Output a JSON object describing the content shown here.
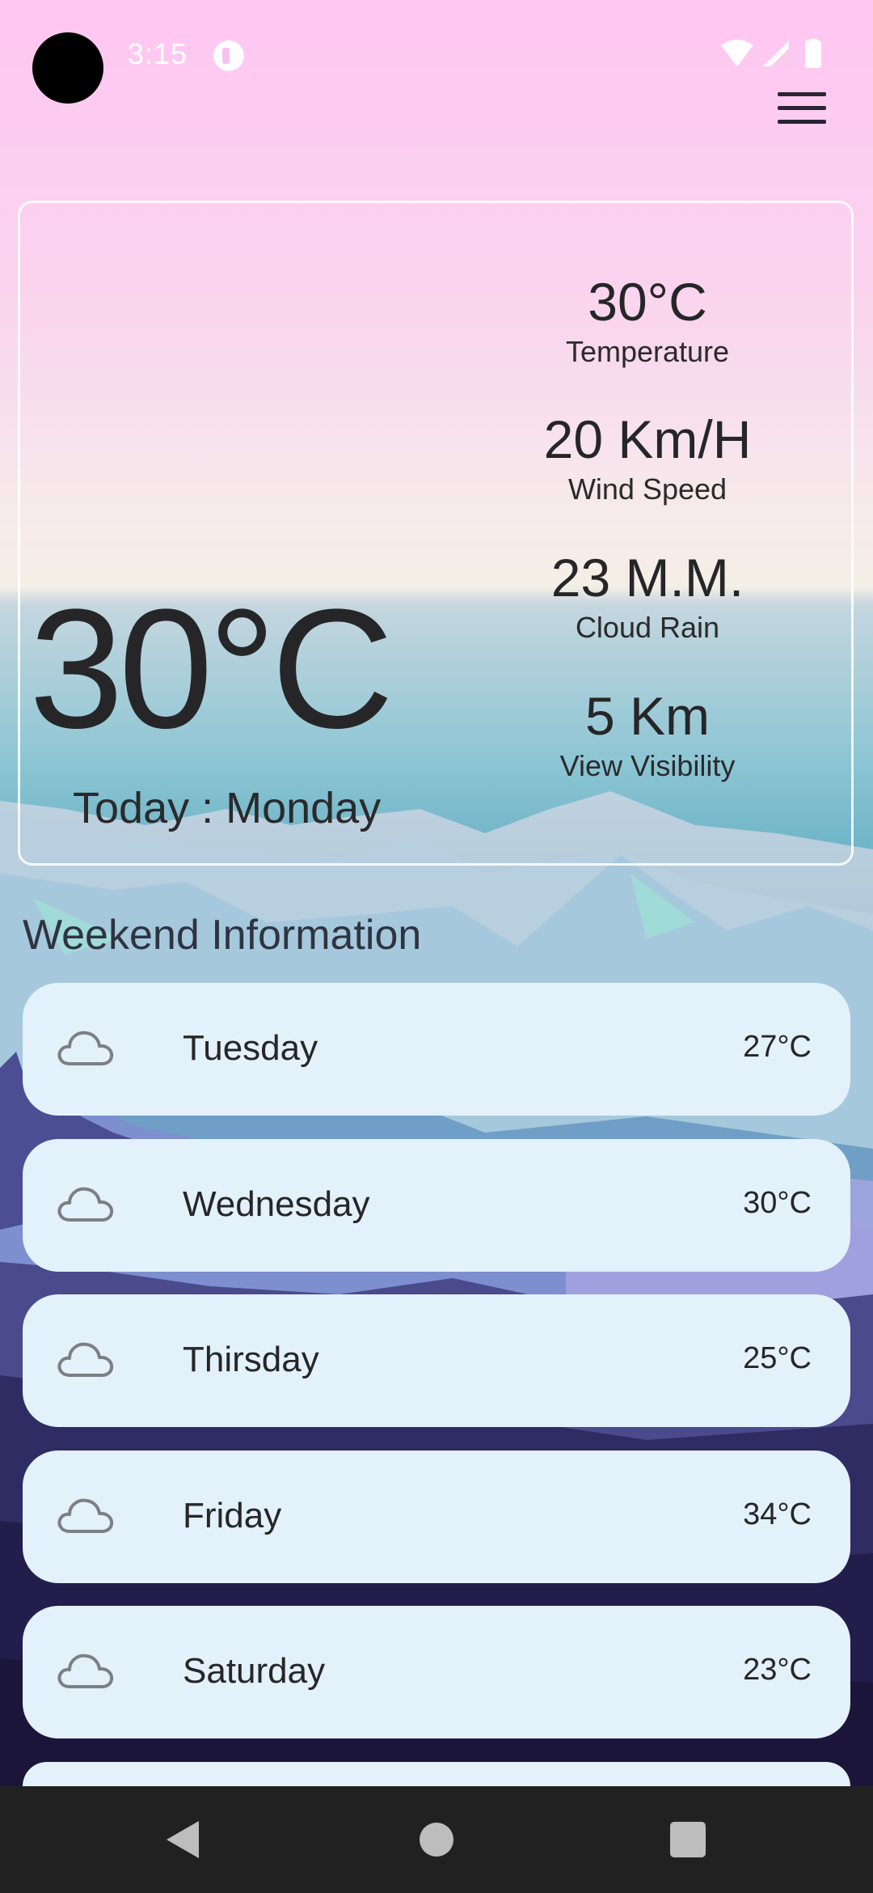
{
  "status_bar": {
    "time": "3:15",
    "icons": [
      "notification-app-icon",
      "wifi-icon",
      "signal-icon",
      "battery-icon"
    ]
  },
  "header": {
    "menu_icon": "hamburger-menu-icon"
  },
  "current": {
    "temperature": "30°C",
    "today": "Today : Monday",
    "stats": [
      {
        "value": "30°C",
        "label": "Temperature"
      },
      {
        "value": "20 Km/H",
        "label": "Wind Speed"
      },
      {
        "value": "23 M.M.",
        "label": "Cloud Rain"
      },
      {
        "value": "5 Km",
        "label": "View Visibility"
      }
    ]
  },
  "weekend": {
    "title": "Weekend Information",
    "days": [
      {
        "day": "Tuesday",
        "temp": "27°C",
        "icon": "cloud-icon"
      },
      {
        "day": "Wednesday",
        "temp": "30°C",
        "icon": "cloud-icon"
      },
      {
        "day": "Thirsday",
        "temp": "25°C",
        "icon": "cloud-icon"
      },
      {
        "day": "Friday",
        "temp": "34°C",
        "icon": "cloud-icon"
      },
      {
        "day": "Saturday",
        "temp": "23°C",
        "icon": "cloud-icon"
      }
    ]
  },
  "nav": {
    "icons": [
      "back-icon",
      "home-icon",
      "recents-icon"
    ]
  },
  "colors": {
    "sky_top": "#ffc8f0",
    "sky_mid": "#f5f0e6",
    "card_bg": "#e3f1fb",
    "nav_bg": "#212121"
  }
}
